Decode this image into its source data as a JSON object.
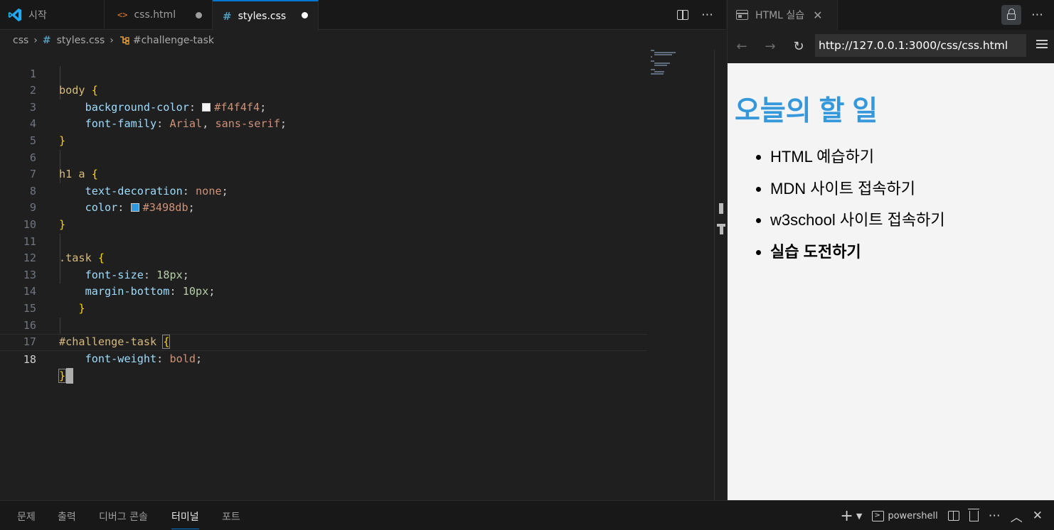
{
  "editor": {
    "tabs": [
      {
        "label": "시작"
      },
      {
        "label": "css.html"
      },
      {
        "label": "styles.css"
      }
    ],
    "breadcrumb": {
      "folder": "css",
      "file": "styles.css",
      "symbol": "#challenge-task"
    },
    "line_numbers": [
      "1",
      "2",
      "3",
      "4",
      "5",
      "6",
      "7",
      "8",
      "9",
      "10",
      "11",
      "12",
      "13",
      "14",
      "15",
      "16",
      "17",
      "18"
    ],
    "code": {
      "l1_sel": "body",
      "l1_brace": "{",
      "l2_prop": "background-color",
      "l2_val": "#f4f4f4",
      "l3_prop": "font-family",
      "l3_val1": "Arial",
      "l3_val2": "sans-serif",
      "l4_brace": "}",
      "l6_sel": "h1 a",
      "l6_brace": "{",
      "l7_prop": "text-decoration",
      "l7_val": "none",
      "l8_prop": "color",
      "l8_val": "#3498db",
      "l9_brace": "}",
      "l11_sel": ".task",
      "l11_brace": "{",
      "l12_prop": "font-size",
      "l12_val": "18px",
      "l13_prop": "margin-bottom",
      "l13_val": "10px",
      "l14_brace": "}",
      "l16_sel": "#challenge-task",
      "l16_brace": "{",
      "l17_prop": "font-weight",
      "l17_val": "bold",
      "l18_brace": "}"
    },
    "swatch_colors": {
      "bg": "#f4f4f4",
      "link": "#3498db"
    }
  },
  "browser": {
    "tab_label": "HTML 실습",
    "url": "http://127.0.0.1:3000/css/css.html",
    "page": {
      "heading": "오늘의 할 일",
      "tasks": [
        {
          "label": "HTML 예습하기"
        },
        {
          "label": "MDN 사이트 접속하기"
        },
        {
          "label": "w3school 사이트 접속하기"
        },
        {
          "label": "실습 도전하기"
        }
      ]
    }
  },
  "panel": {
    "tabs": [
      {
        "label": "문제"
      },
      {
        "label": "출력"
      },
      {
        "label": "디버그 콘솔"
      },
      {
        "label": "터미널"
      },
      {
        "label": "포트"
      }
    ],
    "terminal_label": "powershell"
  }
}
